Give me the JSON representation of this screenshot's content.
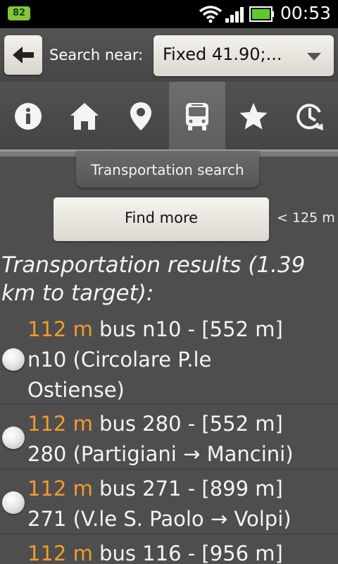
{
  "status_bar": {
    "battery_badge": "82",
    "time": "00:53",
    "icons": [
      "wifi-icon",
      "signal-icon",
      "battery-icon"
    ]
  },
  "top_bar": {
    "back_icon": "back-arrow-icon",
    "search_label": "Search near:",
    "search_value": "Fixed 41.90;..."
  },
  "tabs": [
    {
      "icon": "info-icon",
      "active": false
    },
    {
      "icon": "home-icon",
      "active": false
    },
    {
      "icon": "location-pin-icon",
      "active": false
    },
    {
      "icon": "bus-icon",
      "active": true
    },
    {
      "icon": "star-icon",
      "active": false
    },
    {
      "icon": "history-icon",
      "active": false
    }
  ],
  "section_title": "Transportation search",
  "find_more_label": "Find more",
  "range_label": "< 125 m",
  "results_title": "Transportation results (1.39 km to target):",
  "results": [
    {
      "distance": "112 m",
      "text": " bus n10 - [552 m]\nn10 (Circolare P.le\nOstiense)"
    },
    {
      "distance": "112 m",
      "text": " bus 280 - [552 m]\n280 (Partigiani → Mancini)"
    },
    {
      "distance": "112 m",
      "text": " bus 271 - [899 m]\n271 (V.le S. Paolo → Volpi)"
    },
    {
      "distance": "112 m",
      "text": " bus 116 - [956 m]"
    }
  ],
  "colors": {
    "accent_distance": "#f39a2e",
    "background": "#4e4e4e",
    "battery_badge": "#86c43b"
  }
}
